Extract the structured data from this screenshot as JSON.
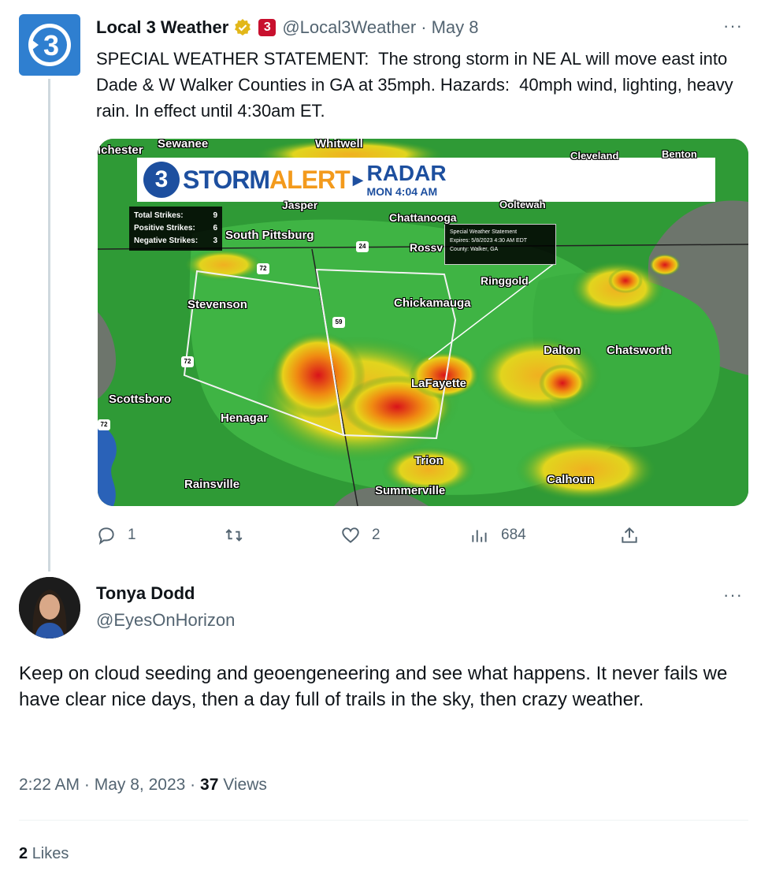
{
  "tweet": {
    "author_name": "Local 3 Weather",
    "handle": "@Local3Weather",
    "date": "May 8",
    "text": "SPECIAL WEATHER STATEMENT:  The strong storm in NE AL will move east into Dade & W Walker Counties in GA at 35mph. Hazards:  40mph wind, lighting, heavy rain. In effect until 4:30am ET.",
    "avatar_label": "3",
    "affiliate_label": "3",
    "separator": "·",
    "media": {
      "banner_number": "3",
      "banner_storm": "STORM",
      "banner_alert": "ALERT",
      "banner_radar": "RADAR",
      "banner_time": "MON 4:04 AM",
      "strikes": [
        {
          "label": "Total Strikes:",
          "value": "9"
        },
        {
          "label": "Positive Strikes:",
          "value": "6"
        },
        {
          "label": "Negative Strikes:",
          "value": "3"
        }
      ],
      "statement_title": "Special Weather Statement",
      "statement_expires": "Expires: 5/8/2023 4:30 AM EDT",
      "statement_county": "County: Walker, GA",
      "towns": {
        "sewanee": "Sewanee",
        "whitwell": "Whitwell",
        "winchester": "ichester",
        "cleveland": "Cleveland",
        "benton": "Benton",
        "jasper": "Jasper",
        "chattanooga": "Chattanooga",
        "ooltewah": "Ooltewah",
        "south_pittsburg": "South Pittsburg",
        "rossville": "Rossv",
        "ringgold": "Ringgold",
        "stevenson": "Stevenson",
        "chickamauga": "Chickamauga",
        "dalton": "Dalton",
        "chatsworth": "Chatsworth",
        "lafayette": "LaFayette",
        "scottsboro": "Scottsboro",
        "henagar": "Henagar",
        "trion": "Trion",
        "rainsville": "Rainsville",
        "summerville": "Summerville",
        "calhoun": "Calhoun"
      },
      "shields": {
        "s72a": "72",
        "s72b": "72",
        "s72c": "72",
        "s59": "59",
        "s24": "24",
        "s75": "75"
      }
    },
    "actions": {
      "replies": "1",
      "retweets": "",
      "likes": "2",
      "views": "684"
    },
    "more": "···"
  },
  "reply": {
    "author_name": "Tonya Dodd",
    "handle": "@EyesOnHorizon",
    "text": "Keep on cloud seeding and geoengeneering and see what happens. It never fails we have clear nice days, then a day full of trails in the sky, then crazy weather.",
    "time": "2:22 AM",
    "date": "May 8, 2023",
    "views_count": "37",
    "views_label": "Views",
    "separator": "·",
    "likes_count": "2",
    "likes_label": "Likes",
    "more": "···"
  },
  "colors": {
    "verified_gold": "#e2b719",
    "brand_blue": "#2f7fd0",
    "muted": "#536471"
  }
}
